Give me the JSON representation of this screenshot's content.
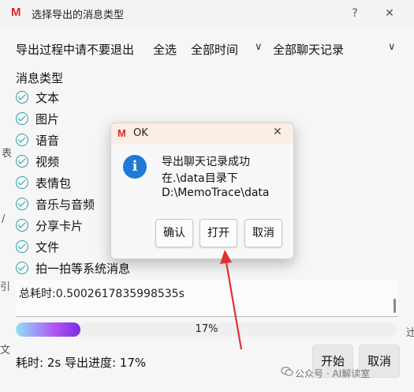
{
  "window": {
    "logo": "M",
    "title": "选择导出的消息类型",
    "help_glyph": "?",
    "close_glyph": "✕"
  },
  "toolbar": {
    "warning": "导出过程中请不要退出",
    "select_all": "全选",
    "time_range": "全部时间",
    "chat_range": "全部聊天记录",
    "chevron": "∨"
  },
  "message_types": {
    "label": "消息类型",
    "items": [
      "文本",
      "图片",
      "语音",
      "视频",
      "表情包",
      "音乐与音频",
      "分享卡片",
      "文件",
      "拍一拍等系统消息"
    ]
  },
  "log": {
    "text": "总耗时:0.5002617835998535s"
  },
  "progress": {
    "percent": 17,
    "label": "17%"
  },
  "status": {
    "text": "耗时: 2s 导出进度: 17%"
  },
  "buttons": {
    "start": "开始",
    "cancel": "取消"
  },
  "watermark": {
    "text": "公众号 · AI解读室"
  },
  "dialog": {
    "logo": "M",
    "title": "OK",
    "close_glyph": "✕",
    "icon_glyph": "i",
    "message_lines": [
      "导出聊天记录成功",
      "在.\\data目录下",
      "D:\\MemoTrace\\data"
    ],
    "buttons": [
      "确认",
      "打开",
      "取消"
    ]
  },
  "colors": {
    "check": "#2aa0a6",
    "logo": "#d32b2b",
    "info": "#1d7ad6",
    "arrow": "#e03030",
    "progress_start": "#8fe0f5",
    "progress_end": "#7a2be0"
  }
}
